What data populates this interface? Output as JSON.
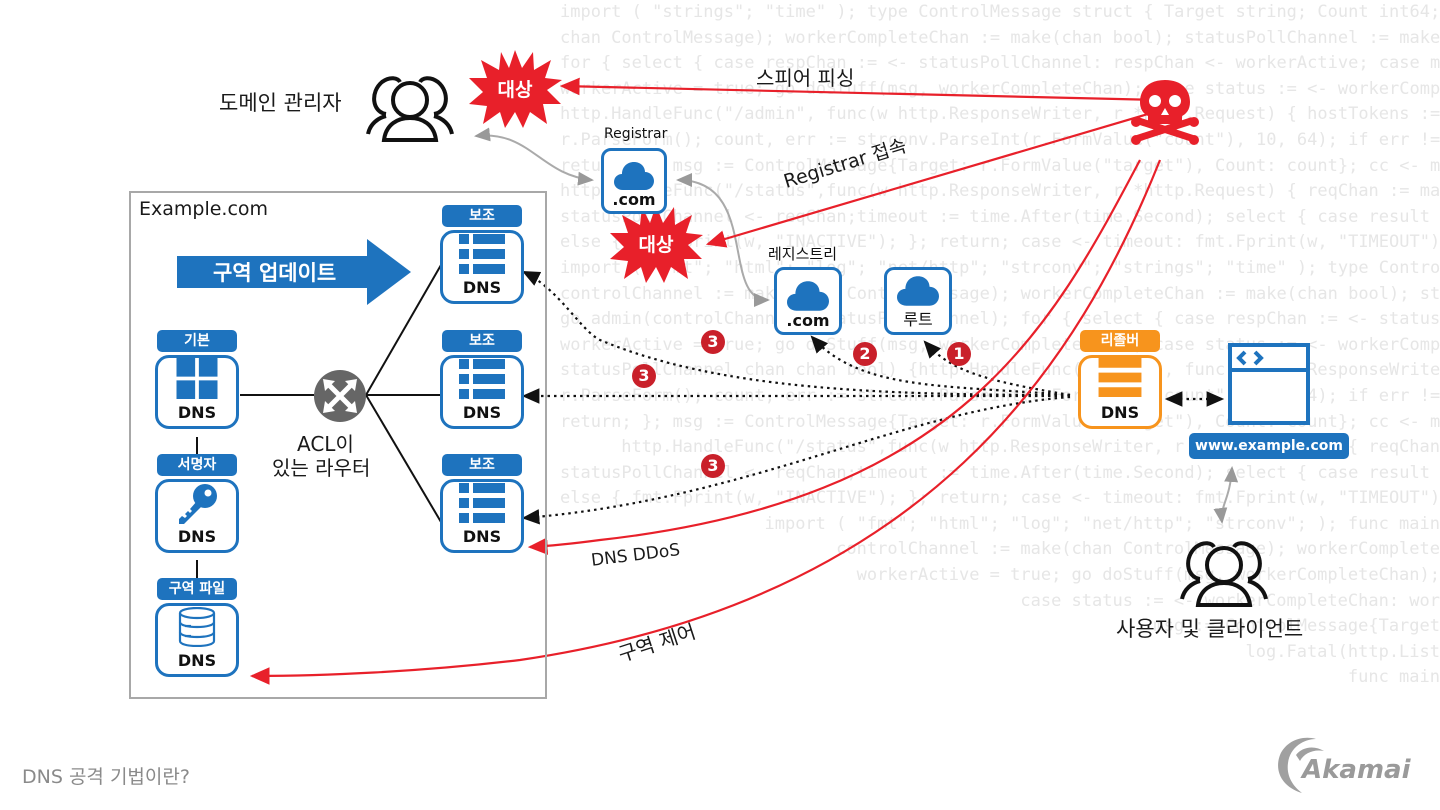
{
  "title": "DNS 공격 기법이란?",
  "brand": "Akamai",
  "colors": {
    "primary_blue": "#1e73be",
    "resolver_orange": "#f7941d",
    "attack_red": "#e8202a",
    "badge_red": "#c9202a",
    "zone_border": "#a8a8a8",
    "footer_gray": "#8a8a8a"
  },
  "actors": {
    "domain_admin": {
      "label": "도메인 관리자",
      "icon": "users-icon"
    },
    "users_clients": {
      "label": "사용자 및 클라이언트",
      "icon": "users-icon"
    },
    "attacker": {
      "icon": "skull-crossbones-icon"
    }
  },
  "targets": [
    {
      "label": "대상",
      "near": "domain_admin"
    },
    {
      "label": "대상",
      "near": "registrar"
    }
  ],
  "registrar": {
    "heading": "Registrar",
    "label": ".com",
    "icon": "cloud-icon"
  },
  "registry": {
    "heading": "레지스트리",
    "label": ".com",
    "icon": "cloud-icon"
  },
  "root": {
    "label": "루트",
    "icon": "cloud-icon"
  },
  "zone": {
    "title": "Example.com",
    "update_arrow": "구역 업데이트",
    "router_label_line1": "ACL이",
    "router_label_line2": "있는 라우터",
    "primary": {
      "tag": "기본",
      "label": "DNS",
      "icon": "grid-icon"
    },
    "signer": {
      "tag": "서명자",
      "label": "DNS",
      "icon": "key-icon"
    },
    "zone_file": {
      "tag": "구역 파일",
      "label": "DNS",
      "icon": "database-icon"
    },
    "secondaries": [
      {
        "tag": "보조",
        "label": "DNS",
        "icon": "list-icon"
      },
      {
        "tag": "보조",
        "label": "DNS",
        "icon": "list-icon"
      },
      {
        "tag": "보조",
        "label": "DNS",
        "icon": "list-icon"
      }
    ]
  },
  "resolver": {
    "tag": "리졸버",
    "label": "DNS",
    "icon": "server-stack-icon"
  },
  "website": {
    "label": "www.example.com",
    "icon": "browser-code-icon"
  },
  "attacks": {
    "spear_phishing": "스피어 피싱",
    "registrar_access": "Registrar 접속",
    "dns_ddos": "DNS DDoS",
    "zone_control": "구역 제어"
  },
  "steps": [
    "1",
    "2",
    "3",
    "3",
    "3"
  ],
  "watermark_code": [
    "import ( \"strings\"; \"time\" ); type ControlMessage struct { Target string; Count int64; }",
    "chan ControlMessage); workerCompleteChan := make(chan bool); statusPollChannel := make(chan chan bool); workerActive := false;",
    "for { select { case respChan := <- statusPollChannel: respChan <- workerActive; case msg := <- controlChannel:",
    "workerActive = true; go doStuff(msg, workerCompleteChan); case status := <- workerCompleteChan: workerActive = status;",
    "http.HandleFunc(\"/admin\", func(w http.ResponseWriter, r *http.Request) { hostTokens := strings.Split(r.Host, \":\");",
    "r.ParseForm(); count, err := strconv.ParseInt(r.FormValue(\"count\"), 10, 64); if err != nil { fmt.Fprintf(w, err.Error());",
    "return; }; msg := ControlMessage{Target: r.FormValue(\"target\"), Count: count}; cc <- msg; fmt.Fprintf(w, \"Control message issued for Target %s\"",
    "http.HandleFunc(\"/status\",func(w http.ResponseWriter, r *http.Request) { reqChan := make(chan bool);",
    "statusPollChannel <- reqChan;timeout := time.After(time.Second); select { case result := <- reqChan: if result { fmt.Fprint(w, \"ACTIVE\"); }",
    "else { fmt.Fprint(w, \"INACTIVE\"); }; return; case <- timeout: fmt.Fprint(w, \"TIMEOUT\");}}); log.Fatal(http.ListenAndServe(\":1337\", nil)); };package main;",
    "import ( \"fmt\"; \"html\"; \"log\"; \"net/http\"; \"strconv\"; \"strings\"; \"time\" ); type ControlMessage struct { Target string; Count int64; }; func main() {",
    "controlChannel := make(chan ControlMessage); workerCompleteChan := make(chan bool); statusPollChannel := make(chan chan bool); workerActive := false;",
    "go admin(controlChannel, statusPollChannel); for { select { case respChan := <- statusPollChannel: respChan <- workerActive; case msg := <- controlChannel:",
    "workerActive = true; go doStuff(msg, workerCompleteChan); case status := <- workerCompleteChan: workerActive = status; }}}; func admin(cc chan ControlMessage,",
    "statusPollChannel chan chan bool) {http.HandleFunc(\"/admin\", func(w http.ResponseWriter, r *http.Request) { hostTokens := strings.Split(r.Host, \":\");",
    "r.ParseForm(); count, err := strconv.ParseInt(r.FormValue(\"count\"), 10, 64); if err != nil { fmt.Fprintf(w, err.Error());",
    "return; }; msg := ControlMessage{Target: r.FormValue(\"target\"), Count: count}; cc <- msg; fmt.Fprintf(w, \"Control message issued for Target",
    "http.HandleFunc(\"/status\",func(w http.ResponseWriter, r *http.Request) { reqChan",
    "statusPollChannel <- reqChan;timeout := time.After(time.Second); select { case result := <- reqChan: if result { fmt.Fprint(w, \"ACTIVE\"",
    "else { fmt.Fprint(w, \"INACTIVE\"); }; return; case <- timeout: fmt.Fprint(w, \"TIMEOUT\");}}); log.Fatal(http.ListenAndServe(\":1337\", nil)); };pac",
    "import ( \"fmt\"; \"html\"; \"log\"; \"net/http\"; \"strconv\"; ); func main",
    "controlChannel := make(chan ControlMessage); workerComplete",
    "workerActive = true; go doStuff(msg, workerCompleteChan);",
    "case status := <- workerCompleteChan: wor",
    "msg := ControlMessage{Target",
    "log.Fatal(http.List",
    "func main"
  ]
}
